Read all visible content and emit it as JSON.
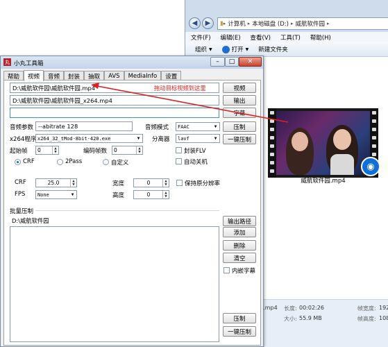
{
  "explorer": {
    "breadcrumbs": [
      "计算机",
      "本地磁盘 (D:)",
      "威航软件园"
    ],
    "menu": [
      "文件(F)",
      "编辑(E)",
      "查看(V)",
      "工具(T)",
      "帮助(H)"
    ],
    "toolbar": {
      "organize": "组织",
      "open": "打开",
      "new_folder": "新建文件夹"
    },
    "file_label": "威航软件园.mp4",
    "details": {
      "name_partial": "l.mp4",
      "length_label": "长度:",
      "length_value": "00:02:26",
      "size_label": "大小:",
      "size_value": "55.9 MB",
      "frame_width_label": "帧宽度:",
      "frame_width_value": "192",
      "frame_height_label": "帧高度:",
      "frame_height_value": "108"
    }
  },
  "tool": {
    "title": "小丸工具箱",
    "app_icon": "丸",
    "tabs": [
      "帮助",
      "视频",
      "音频",
      "封装",
      "抽取",
      "AVS",
      "MediaInfo",
      "设置"
    ],
    "active_tab": "视频",
    "input_path": "D:\\威航软件园\\威航软件园.mp4",
    "hint": "拖动目标视频到这里",
    "output_path": "D:\\威航软件园\\威航软件园_x264.mp4",
    "subtitle_path": "",
    "buttons": {
      "video": "视频",
      "output": "输出",
      "subtitle": "字幕",
      "compress": "压制",
      "one_click": "一键压制",
      "output_path": "输出路径",
      "add": "添加",
      "delete": "删除",
      "clear": "清空",
      "compress2": "压制",
      "one_click2": "一键压制"
    },
    "audio_params_label": "音频参数",
    "audio_params_value": "--abitrate 128",
    "audio_mode_label": "音频模式",
    "audio_mode_value": "FAAC",
    "x264_label": "x264程序",
    "x264_value": "x264_32_tMod-8bit-420.exe",
    "splitter_label": "分离器",
    "splitter_value": "lavf",
    "start_frame_label": "起始帧",
    "start_frame_value": "0",
    "encode_frames_label": "编码帧数",
    "encode_frames_value": "0",
    "encap_flv": "封装FLV",
    "auto_shutdown": "自动关机",
    "modes": [
      "CRF",
      "2Pass",
      "自定义"
    ],
    "selected_mode": "CRF",
    "crf_label": "CRF",
    "crf_value": "25.0",
    "width_label": "宽度",
    "width_value": "0",
    "keep_res": "保持原分辨率",
    "fps_label": "FPS",
    "fps_value": "None",
    "height_label": "高度",
    "height_value": "0",
    "batch_label": "批量压制",
    "batch_items": [
      "D:\\威航软件园"
    ],
    "embed_subs": "内嵌字幕"
  },
  "colors": {
    "hint_red": "#e0201e",
    "arrow_red": "#e0201e",
    "qq_blue": "#0f6fd8"
  }
}
